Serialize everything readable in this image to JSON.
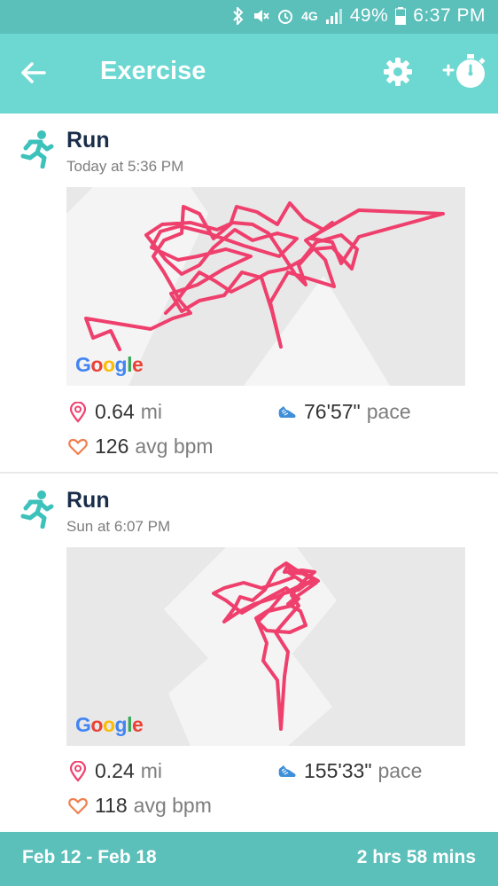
{
  "status_bar": {
    "network": "4G",
    "battery": "49%",
    "time": "6:37 PM"
  },
  "app_bar": {
    "title": "Exercise",
    "back_icon": "arrow-left-icon",
    "settings_icon": "gear-icon",
    "add_timer_icon": "add-stopwatch-icon"
  },
  "activities": [
    {
      "title": "Run",
      "time": "Today at 5:36 PM",
      "map_label": "Google",
      "distance_value": "0.64",
      "distance_unit": "mi",
      "pace_value": "76'57\"",
      "pace_unit": "pace",
      "bpm_value": "126",
      "bpm_unit": "avg bpm"
    },
    {
      "title": "Run",
      "time": "Sun at 6:07 PM",
      "map_label": "Google",
      "distance_value": "0.24",
      "distance_unit": "mi",
      "pace_value": "155'33\"",
      "pace_unit": "pace",
      "bpm_value": "118",
      "bpm_unit": "avg bpm"
    }
  ],
  "bottom_bar": {
    "date_range": "Feb 12 - Feb 18",
    "total_duration": "2 hrs 58 mins"
  },
  "colors": {
    "status_bar": "#5bbfba",
    "app_bar": "#6dd8d2",
    "route": "#f0416f",
    "run_icon": "#3cc1bb",
    "title_text": "#1a2e4a"
  }
}
